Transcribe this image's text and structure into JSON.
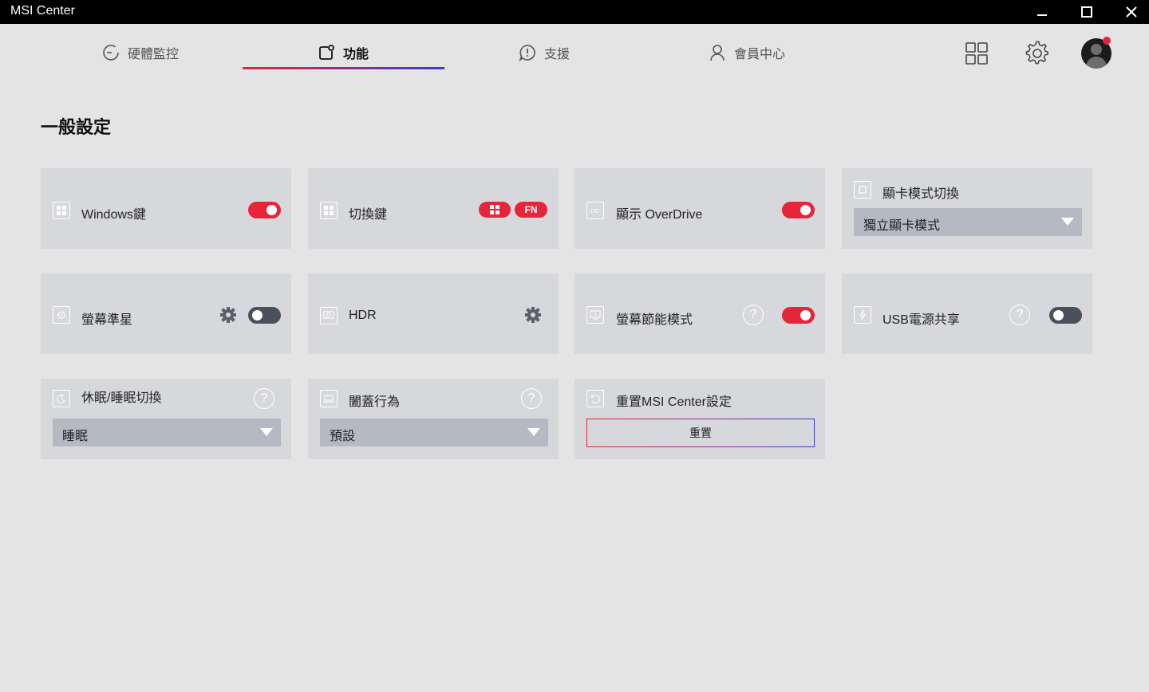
{
  "window": {
    "title": "MSI Center"
  },
  "nav": {
    "tabs": [
      {
        "label": "硬體監控",
        "icon": "gauge-icon"
      },
      {
        "label": "功能",
        "icon": "feature-icon"
      },
      {
        "label": "支援",
        "icon": "support-icon"
      },
      {
        "label": "會員中心",
        "icon": "user-icon"
      }
    ],
    "active_tab": "功能",
    "accent": "#e6243a"
  },
  "page": {
    "title": "一般設定"
  },
  "cards": {
    "windows_key": {
      "label": "Windows鍵",
      "toggle": "on"
    },
    "switch_key": {
      "label": "切換鍵",
      "fn_label": "FN"
    },
    "overdrive": {
      "label": "顯示 OverDrive",
      "toggle": "on"
    },
    "gpu_mode": {
      "label": "顯卡模式切換",
      "value": "獨立顯卡模式"
    },
    "crosshair": {
      "label": "螢幕準星",
      "toggle": "off"
    },
    "hdr": {
      "label": "HDR"
    },
    "screen_saver": {
      "label": "螢幕節能模式",
      "toggle": "on",
      "help": "?"
    },
    "usb_share": {
      "label": "USB電源共享",
      "toggle": "off",
      "help": "?"
    },
    "sleep_switch": {
      "label": "休眠/睡眠切換",
      "value": "睡眠",
      "help": "?"
    },
    "lid_action": {
      "label": "闔蓋行為",
      "value": "預設",
      "help": "?"
    },
    "reset": {
      "label": "重置MSI Center設定",
      "button": "重置"
    }
  }
}
